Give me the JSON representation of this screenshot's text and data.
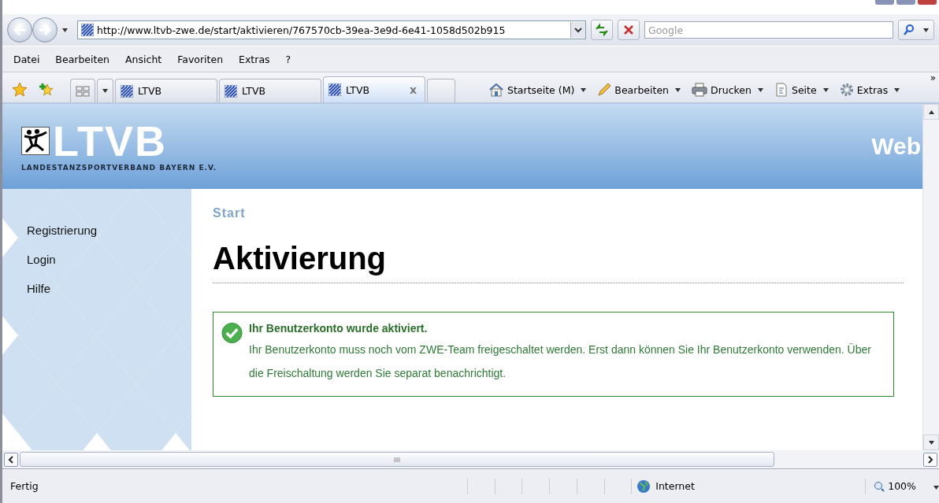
{
  "address_bar": {
    "value": "http://www.ltvb-zwe.de/start/aktivieren/767570cb-39ea-3e9d-6e41-1058d502b915"
  },
  "search": {
    "placeholder": "Google"
  },
  "menu": [
    "Datei",
    "Bearbeiten",
    "Ansicht",
    "Favoriten",
    "Extras",
    "?"
  ],
  "tabs": [
    {
      "label": "LTVB",
      "selected": false
    },
    {
      "label": "LTVB",
      "selected": false
    },
    {
      "label": "LTVB",
      "selected": true
    }
  ],
  "close_tab": "x",
  "command_bar": [
    {
      "kind": "home",
      "label": "Startseite (M)"
    },
    {
      "kind": "pencil",
      "label": "Bearbeiten"
    },
    {
      "kind": "printer",
      "label": "Drucken"
    },
    {
      "kind": "page",
      "label": "Seite"
    },
    {
      "kind": "gear",
      "label": "Extras"
    }
  ],
  "more": "»",
  "header": {
    "logo_text": "LTVB",
    "logo_subtitle": "LANDESTANZSPORTVERBAND BAYERN E.V.",
    "title": "Web"
  },
  "sidebar": {
    "items": [
      "Registrierung",
      "Login",
      "Hilfe"
    ]
  },
  "breadcrumb": "Start",
  "heading": "Aktivierung",
  "message": {
    "kind": "success",
    "title": "Ihr Benutzerkonto wurde aktiviert.",
    "text": "Ihr Benutzerkonto muss noch vom ZWE-Team freigeschaltet werden. Erst dann können Sie Ihr Benutzerkonto verwenden. Über die Freischaltung werden Sie separat benachrichtigt."
  },
  "status_bar": {
    "status": "Fertig",
    "zone": "Internet",
    "zoom": "100%"
  }
}
